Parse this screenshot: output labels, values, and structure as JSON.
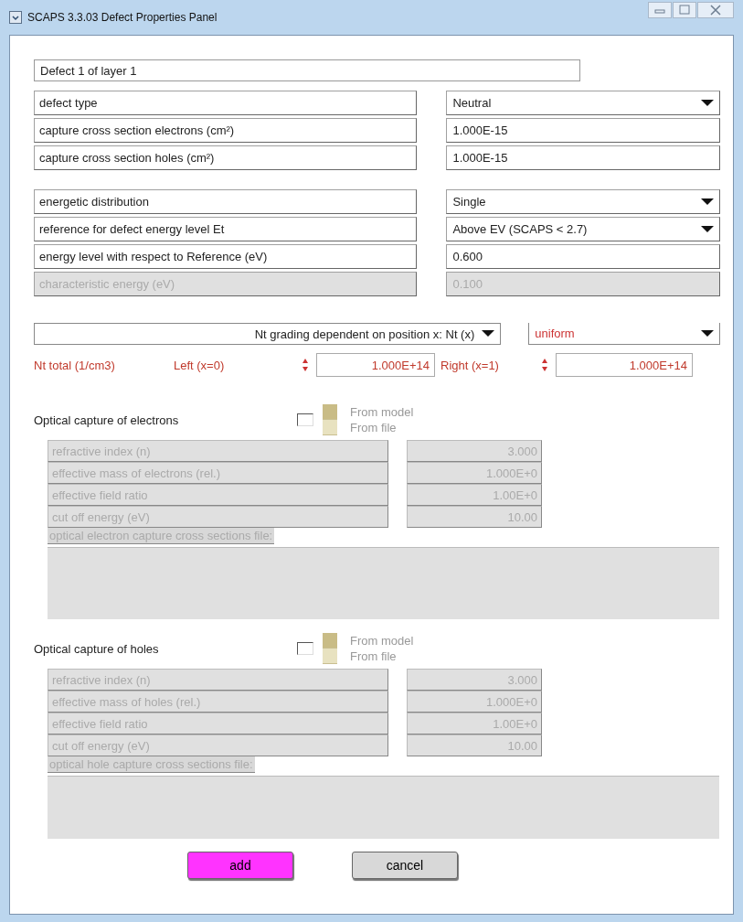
{
  "window": {
    "title": "SCAPS 3.3.03 Defect Properties Panel"
  },
  "defect_name": "Defect 1 of layer 1",
  "groups": [
    [
      {
        "label": "defect type",
        "kind": "select",
        "value": "Neutral",
        "disabled": false
      },
      {
        "label": "capture cross section electrons (cm²)",
        "kind": "input",
        "value": "1.000E-15",
        "disabled": false
      },
      {
        "label": "capture cross section holes (cm²)",
        "kind": "input",
        "value": "1.000E-15",
        "disabled": false
      }
    ],
    [
      {
        "label": "energetic distribution",
        "kind": "select",
        "value": "Single",
        "disabled": false
      },
      {
        "label": "reference for defect energy level Et",
        "kind": "select",
        "value": "Above EV (SCAPS < 2.7)",
        "disabled": false
      },
      {
        "label": "energy level with respect to Reference (eV)",
        "kind": "input",
        "value": "0.600",
        "disabled": false
      },
      {
        "label": "characteristic energy (eV)",
        "kind": "input",
        "value": "0.100",
        "disabled": true
      }
    ]
  ],
  "grading": {
    "label": "Nt grading dependent on position x: Nt (x)",
    "profile": "uniform"
  },
  "nt_total": {
    "label": "Nt total (1/cm3)",
    "left_label": "Left (x=0)",
    "left_value": "1.000E+14",
    "right_label": "Right (x=1)",
    "right_value": "1.000E+14"
  },
  "optical": [
    {
      "heading": "Optical capture of electrons",
      "checked": false,
      "sources": [
        {
          "label": "From model",
          "selected": true
        },
        {
          "label": "From file",
          "selected": false
        }
      ],
      "params": [
        {
          "label": "refractive index (n)",
          "value": "3.000"
        },
        {
          "label": "effective mass of electrons (rel.)",
          "value": "1.000E+0"
        },
        {
          "label": "effective field ratio",
          "value": "1.00E+0"
        },
        {
          "label": "cut off energy (eV)",
          "value": "10.00"
        }
      ],
      "file_label": "optical electron capture cross sections file:"
    },
    {
      "heading": "Optical capture of holes",
      "checked": false,
      "sources": [
        {
          "label": "From model",
          "selected": true
        },
        {
          "label": "From file",
          "selected": false
        }
      ],
      "params": [
        {
          "label": "refractive index (n)",
          "value": "3.000"
        },
        {
          "label": "effective mass of holes (rel.)",
          "value": "1.000E+0"
        },
        {
          "label": "effective field ratio",
          "value": "1.00E+0"
        },
        {
          "label": "cut off energy (eV)",
          "value": "10.00"
        }
      ],
      "file_label": "optical hole capture cross sections file:"
    }
  ],
  "buttons": [
    {
      "label": "add",
      "kind": "primary"
    },
    {
      "label": "cancel",
      "kind": "secondary"
    }
  ]
}
